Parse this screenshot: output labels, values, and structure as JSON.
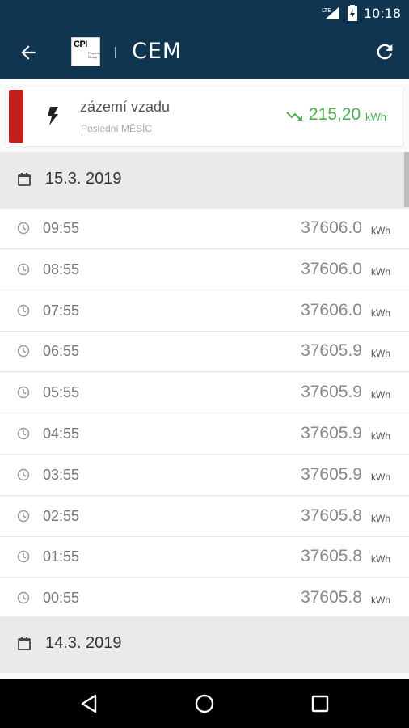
{
  "status_bar": {
    "time": "10:18",
    "network_label": "LTE"
  },
  "app_bar": {
    "brand_left": "CPI",
    "brand_left_sub": "Property Group",
    "brand_right": "CEM"
  },
  "meter": {
    "name": "zázemí vzadu",
    "period": "Poslední MĚSÍC",
    "value": "215,20",
    "unit": "kWh",
    "accent_color": "#c21e1e",
    "value_color": "#4caf50",
    "icon": "lightning-bolt-icon",
    "trend_icon": "trend-down-icon"
  },
  "days": [
    {
      "date": "15.3. 2019",
      "readings": [
        {
          "time": "09:55",
          "value": "37606.0",
          "unit": "kWh"
        },
        {
          "time": "08:55",
          "value": "37606.0",
          "unit": "kWh"
        },
        {
          "time": "07:55",
          "value": "37606.0",
          "unit": "kWh"
        },
        {
          "time": "06:55",
          "value": "37605.9",
          "unit": "kWh"
        },
        {
          "time": "05:55",
          "value": "37605.9",
          "unit": "kWh"
        },
        {
          "time": "04:55",
          "value": "37605.9",
          "unit": "kWh"
        },
        {
          "time": "03:55",
          "value": "37605.9",
          "unit": "kWh"
        },
        {
          "time": "02:55",
          "value": "37605.8",
          "unit": "kWh"
        },
        {
          "time": "01:55",
          "value": "37605.8",
          "unit": "kWh"
        },
        {
          "time": "00:55",
          "value": "37605.8",
          "unit": "kWh"
        }
      ]
    },
    {
      "date": "14.3. 2019",
      "readings": []
    }
  ],
  "colors": {
    "app_bar": "#0f3550",
    "day_header": "#eaeaea"
  }
}
